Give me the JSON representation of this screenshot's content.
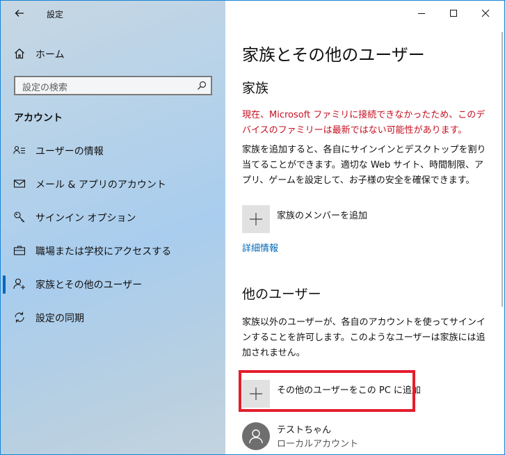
{
  "app": {
    "title": "設定"
  },
  "sidebar": {
    "home": "ホーム",
    "search_placeholder": "設定の検索",
    "section": "アカウント",
    "items": [
      {
        "label": "ユーザーの情報",
        "icon": "user-info-icon"
      },
      {
        "label": "メール & アプリのアカウント",
        "icon": "mail-icon"
      },
      {
        "label": "サインイン オプション",
        "icon": "key-icon"
      },
      {
        "label": "職場または学校にアクセスする",
        "icon": "briefcase-icon"
      },
      {
        "label": "家族とその他のユーザー",
        "icon": "person-add-icon",
        "selected": true
      },
      {
        "label": "設定の同期",
        "icon": "sync-icon"
      }
    ]
  },
  "main": {
    "title": "家族とその他のユーザー",
    "family": {
      "heading": "家族",
      "warning": "現在、Microsoft ファミリに接続できなかったため、このデバイスのファミリーは最新ではない可能性があります。",
      "description": "家族を追加すると、各自にサインインとデスクトップを割り当てることができます。適切な Web サイト、時間制限、アプリ、ゲームを設定して、お子様の安全を確保できます。",
      "add_label": "家族のメンバーを追加",
      "details_link": "詳細情報"
    },
    "others": {
      "heading": "他のユーザー",
      "description": "家族以外のユーザーが、各自のアカウントを使ってサインインすることを許可します。このようなユーザーは家族には追加されません。",
      "add_label": "その他のユーザーをこの PC に追加",
      "user_name": "テストちゃん",
      "user_type": "ローカルアカウント"
    }
  },
  "colors": {
    "accent": "#0067b8",
    "warning": "#c50f1f",
    "highlight": "#e41d2d"
  }
}
